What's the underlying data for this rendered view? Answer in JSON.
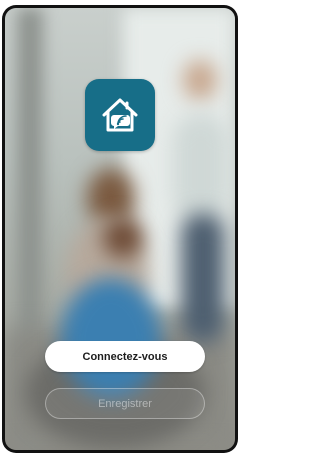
{
  "app": {
    "icon": "smart-home-wifi-icon"
  },
  "actions": {
    "login_label": "Connectez-vous",
    "register_label": "Enregistrer"
  },
  "colors": {
    "icon_background": "#176e88",
    "login_button": "#ffffff",
    "login_text": "#1d1d1d"
  }
}
